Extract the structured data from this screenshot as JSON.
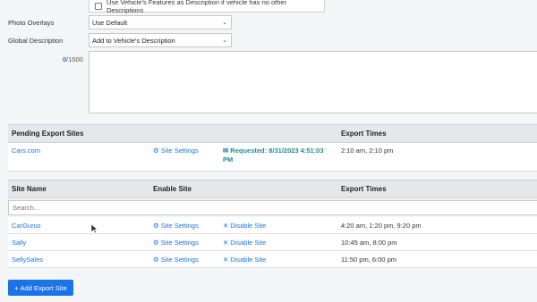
{
  "features_checkbox": {
    "label": "Use Vehicle's Features as Description if vehicle has no other Descriptions",
    "checked": false
  },
  "photo_overlays": {
    "label": "Photo Overlays",
    "value": "Use Default"
  },
  "global_description": {
    "label": "Global Description",
    "value": "Add to Vehicle's Description"
  },
  "description": {
    "count": "0",
    "max": "/1500",
    "value": ""
  },
  "pending_table": {
    "headers": {
      "site": "Pending Export Sites",
      "times": "Export Times"
    },
    "rows": [
      {
        "site": "Cars.com",
        "settings": "Site Settings",
        "status": "Requested: 8/31/2023 4:51:03 PM",
        "status_line1": "Requested: 8/31/2023 4:51:03",
        "status_line2": "PM",
        "times": "2:10 am, 2:10 pm"
      }
    ]
  },
  "sites_table": {
    "headers": {
      "site": "Site Name",
      "enable": "Enable Site",
      "times": "Export Times"
    },
    "search_placeholder": "Search...",
    "rows": [
      {
        "site": "CarGurus",
        "settings": "Site Settings",
        "disable": "Disable Site",
        "times": "4:20 am, 1:20 pm, 9:20 pm"
      },
      {
        "site": "Sally",
        "settings": "Site Settings",
        "disable": "Disable Site",
        "times": "10:45 am, 8:00 pm"
      },
      {
        "site": "SellySales",
        "settings": "Site Settings",
        "disable": "Disable Site",
        "times": "11:50 pm, 6:00 pm"
      }
    ]
  },
  "add_button": {
    "label": "Add Export Site"
  },
  "colors": {
    "link": "#1a73e8",
    "status": "#1a8a9c",
    "header_bg": "#e6e7ea",
    "button": "#1a73e8"
  }
}
